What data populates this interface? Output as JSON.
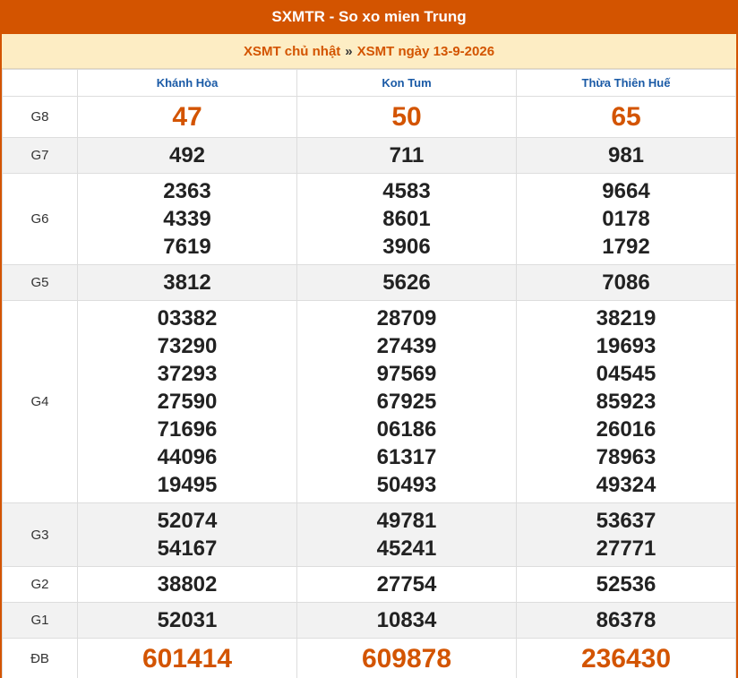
{
  "header": {
    "title": "SXMTR - So xo mien Trung"
  },
  "breadcrumb": {
    "day_link": "XSMT chủ nhật",
    "separator": "»",
    "date_link": "XSMT ngày 13-9-2026"
  },
  "provinces": [
    "Khánh Hòa",
    "Kon Tum",
    "Thừa Thiên Huế"
  ],
  "prizes": [
    {
      "label": "G8",
      "values": [
        [
          "47"
        ],
        [
          "50"
        ],
        [
          "65"
        ]
      ]
    },
    {
      "label": "G7",
      "values": [
        [
          "492"
        ],
        [
          "711"
        ],
        [
          "981"
        ]
      ]
    },
    {
      "label": "G6",
      "values": [
        [
          "2363",
          "4339",
          "7619"
        ],
        [
          "4583",
          "8601",
          "3906"
        ],
        [
          "9664",
          "0178",
          "1792"
        ]
      ]
    },
    {
      "label": "G5",
      "values": [
        [
          "3812"
        ],
        [
          "5626"
        ],
        [
          "7086"
        ]
      ]
    },
    {
      "label": "G4",
      "values": [
        [
          "03382",
          "73290",
          "37293",
          "27590",
          "71696",
          "44096",
          "19495"
        ],
        [
          "28709",
          "27439",
          "97569",
          "67925",
          "06186",
          "61317",
          "50493"
        ],
        [
          "38219",
          "19693",
          "04545",
          "85923",
          "26016",
          "78963",
          "49324"
        ]
      ]
    },
    {
      "label": "G3",
      "values": [
        [
          "52074",
          "54167"
        ],
        [
          "49781",
          "45241"
        ],
        [
          "53637",
          "27771"
        ]
      ]
    },
    {
      "label": "G2",
      "values": [
        [
          "38802"
        ],
        [
          "27754"
        ],
        [
          "52536"
        ]
      ]
    },
    {
      "label": "G1",
      "values": [
        [
          "52031"
        ],
        [
          "10834"
        ],
        [
          "86378"
        ]
      ]
    },
    {
      "label": "ĐB",
      "values": [
        [
          "601414"
        ],
        [
          "609878"
        ],
        [
          "236430"
        ]
      ]
    }
  ],
  "colors": {
    "brand": "#d35400",
    "crumb_bg": "#fdedc4",
    "province_link": "#1a5aa6"
  }
}
